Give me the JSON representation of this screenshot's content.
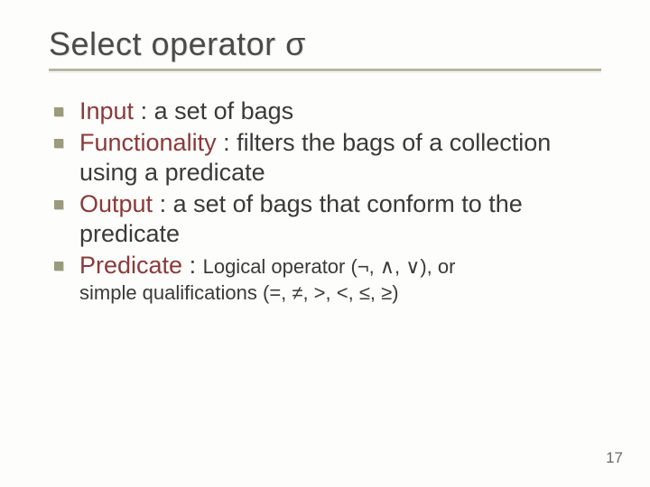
{
  "title_prefix": "Select operator ",
  "title_symbol": "σ",
  "bullets": [
    {
      "label": "Input",
      "sep": " : ",
      "text": "a set of bags"
    },
    {
      "label": "Functionality",
      "sep": " : ",
      "text": "filters the bags of a collection using a predicate"
    },
    {
      "label": "Output",
      "sep": " : ",
      "text": "a set of bags that conform to the predicate"
    },
    {
      "label": "Predicate",
      "sep": " : ",
      "text": ""
    }
  ],
  "predicate_small_lead": "Logical operator (",
  "predicate_ops": "¬, ∧, ∨",
  "predicate_small_mid": "), or",
  "predicate_line2_a": "simple qualifications (",
  "predicate_quals": "=, ≠, >, <, ≤, ≥",
  "predicate_line2_b": ")",
  "page_number": "17"
}
